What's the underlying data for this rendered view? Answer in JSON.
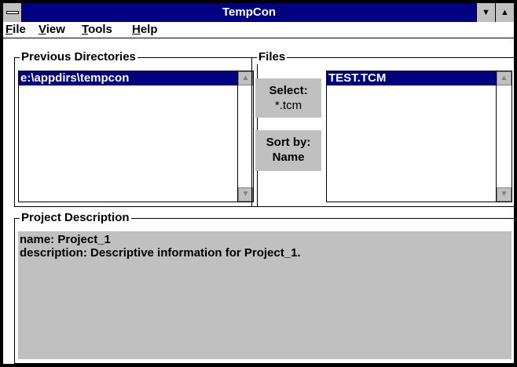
{
  "window": {
    "title": "TempCon"
  },
  "menu": {
    "items": [
      {
        "label": "File",
        "mnemonic": "F",
        "rest": "ile"
      },
      {
        "label": "View",
        "mnemonic": "V",
        "rest": "iew"
      },
      {
        "label": "Tools",
        "mnemonic": "T",
        "rest": "ools"
      },
      {
        "label": "Help",
        "mnemonic": "H",
        "rest": "elp"
      }
    ]
  },
  "previous_directories": {
    "label": "Previous Directories",
    "items": [
      "e:\\appdirs\\tempcon"
    ],
    "selected_index": 0
  },
  "files": {
    "label": "Files",
    "select_button": {
      "line1": "Select:",
      "line2": "*.tcm"
    },
    "sort_button": {
      "line1": "Sort by:",
      "line2": "Name"
    },
    "items": [
      "TEST.TCM"
    ],
    "selected_index": 0
  },
  "project_description": {
    "label": "Project Description",
    "line1": "name: Project_1",
    "line2": "description: Descriptive information for Project_1."
  },
  "colors": {
    "titlebar": "#000080",
    "selection": "#000080",
    "button_face": "#c0c0c0"
  },
  "icons": {
    "system_menu": "system-menu-icon",
    "minimize": "minimize-icon",
    "maximize": "maximize-icon",
    "scroll_up": "scroll-up-arrow-icon",
    "scroll_down": "scroll-down-arrow-icon"
  }
}
